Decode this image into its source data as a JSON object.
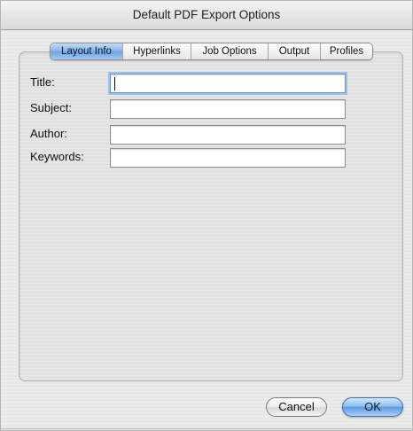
{
  "window": {
    "title": "Default PDF Export Options"
  },
  "tabs": [
    {
      "label": "Layout Info",
      "active": true
    },
    {
      "label": "Hyperlinks",
      "active": false
    },
    {
      "label": "Job Options",
      "active": false
    },
    {
      "label": "Output",
      "active": false
    },
    {
      "label": "Profiles",
      "active": false
    }
  ],
  "fields": [
    {
      "label": "Title:",
      "value": "",
      "focused": true
    },
    {
      "label": "Subject:",
      "value": ""
    },
    {
      "label": "Author:",
      "value": ""
    },
    {
      "label": "Keywords:",
      "value": ""
    }
  ],
  "buttons": {
    "cancel": "Cancel",
    "ok": "OK"
  },
  "colors": {
    "accent": "#6fa3e3",
    "window_bg": "#e8e8e8"
  }
}
